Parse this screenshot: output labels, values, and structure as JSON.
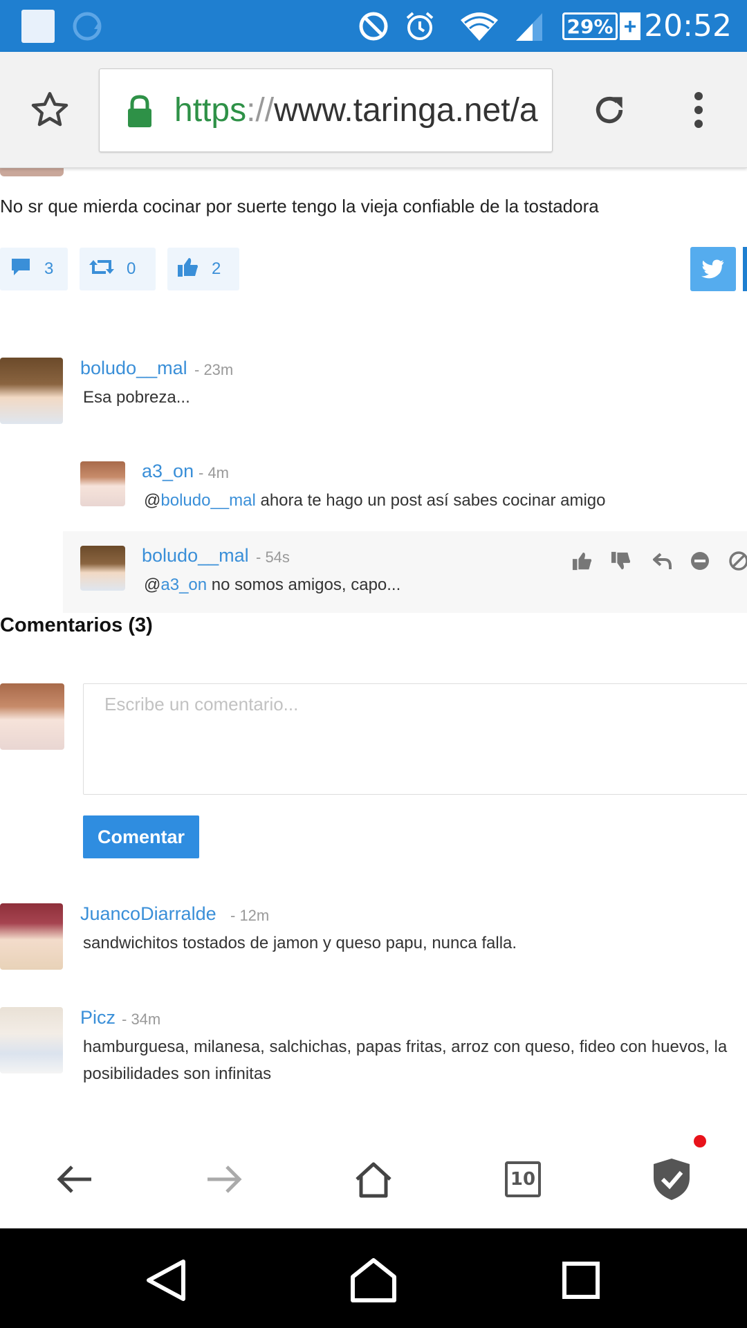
{
  "status_bar": {
    "time": "20:52",
    "battery": "29%",
    "battery_plus": "+"
  },
  "browser": {
    "url_protocol": "https",
    "url_separator": "://",
    "url_host": "www.taringa.net/a"
  },
  "post": {
    "text": "No sr que mierda cocinar por suerte tengo la vieja confiable de la tostadora",
    "comments_count": "3",
    "shares_count": "0",
    "likes_count": "2"
  },
  "thread": {
    "comment": {
      "user": "boludo__mal",
      "time": "- 23m",
      "text": "Esa pobreza..."
    },
    "replies": [
      {
        "user": "a3_on",
        "time": "- 4m",
        "prefix": "@",
        "mention": "boludo__mal",
        "text": " ahora te hago un post así sabes cocinar amigo"
      },
      {
        "user": "boludo__mal",
        "time": "- 54s",
        "prefix": "@",
        "mention": "a3_on",
        "text": " no somos amigos, capo..."
      }
    ]
  },
  "comments_section": {
    "title": "Comentarios (3)",
    "input_placeholder": "Escribe un comentario...",
    "submit_label": "Comentar"
  },
  "comments": [
    {
      "user": "JuancoDiarralde",
      "time": "- 12m",
      "text": "sandwichitos tostados de jamon y queso papu, nunca falla."
    },
    {
      "user": "Picz",
      "time": "- 34m",
      "text_line1": "hamburguesa, milanesa, salchichas, papas fritas, arroz con queso, fideo con huevos, la",
      "text_line2": "posibilidades son infinitas"
    }
  ],
  "bottom_nav": {
    "tabs_count": "10"
  },
  "colors": {
    "status_bar": "#1f7fd0",
    "link": "#3a8fd8",
    "button": "#2f8de0",
    "twitter": "#55acee",
    "lock_green": "#2e9147"
  },
  "icons": [
    "star-icon",
    "lock-icon",
    "reload-icon",
    "overflow-menu-icon",
    "comment-icon",
    "retweet-icon",
    "thumbs-up-icon",
    "twitter-icon",
    "like-icon",
    "dislike-icon",
    "reply-icon",
    "hide-icon",
    "block-icon",
    "back-arrow-icon",
    "forward-arrow-icon",
    "home-icon",
    "tabs-icon",
    "shield-check-icon"
  ]
}
